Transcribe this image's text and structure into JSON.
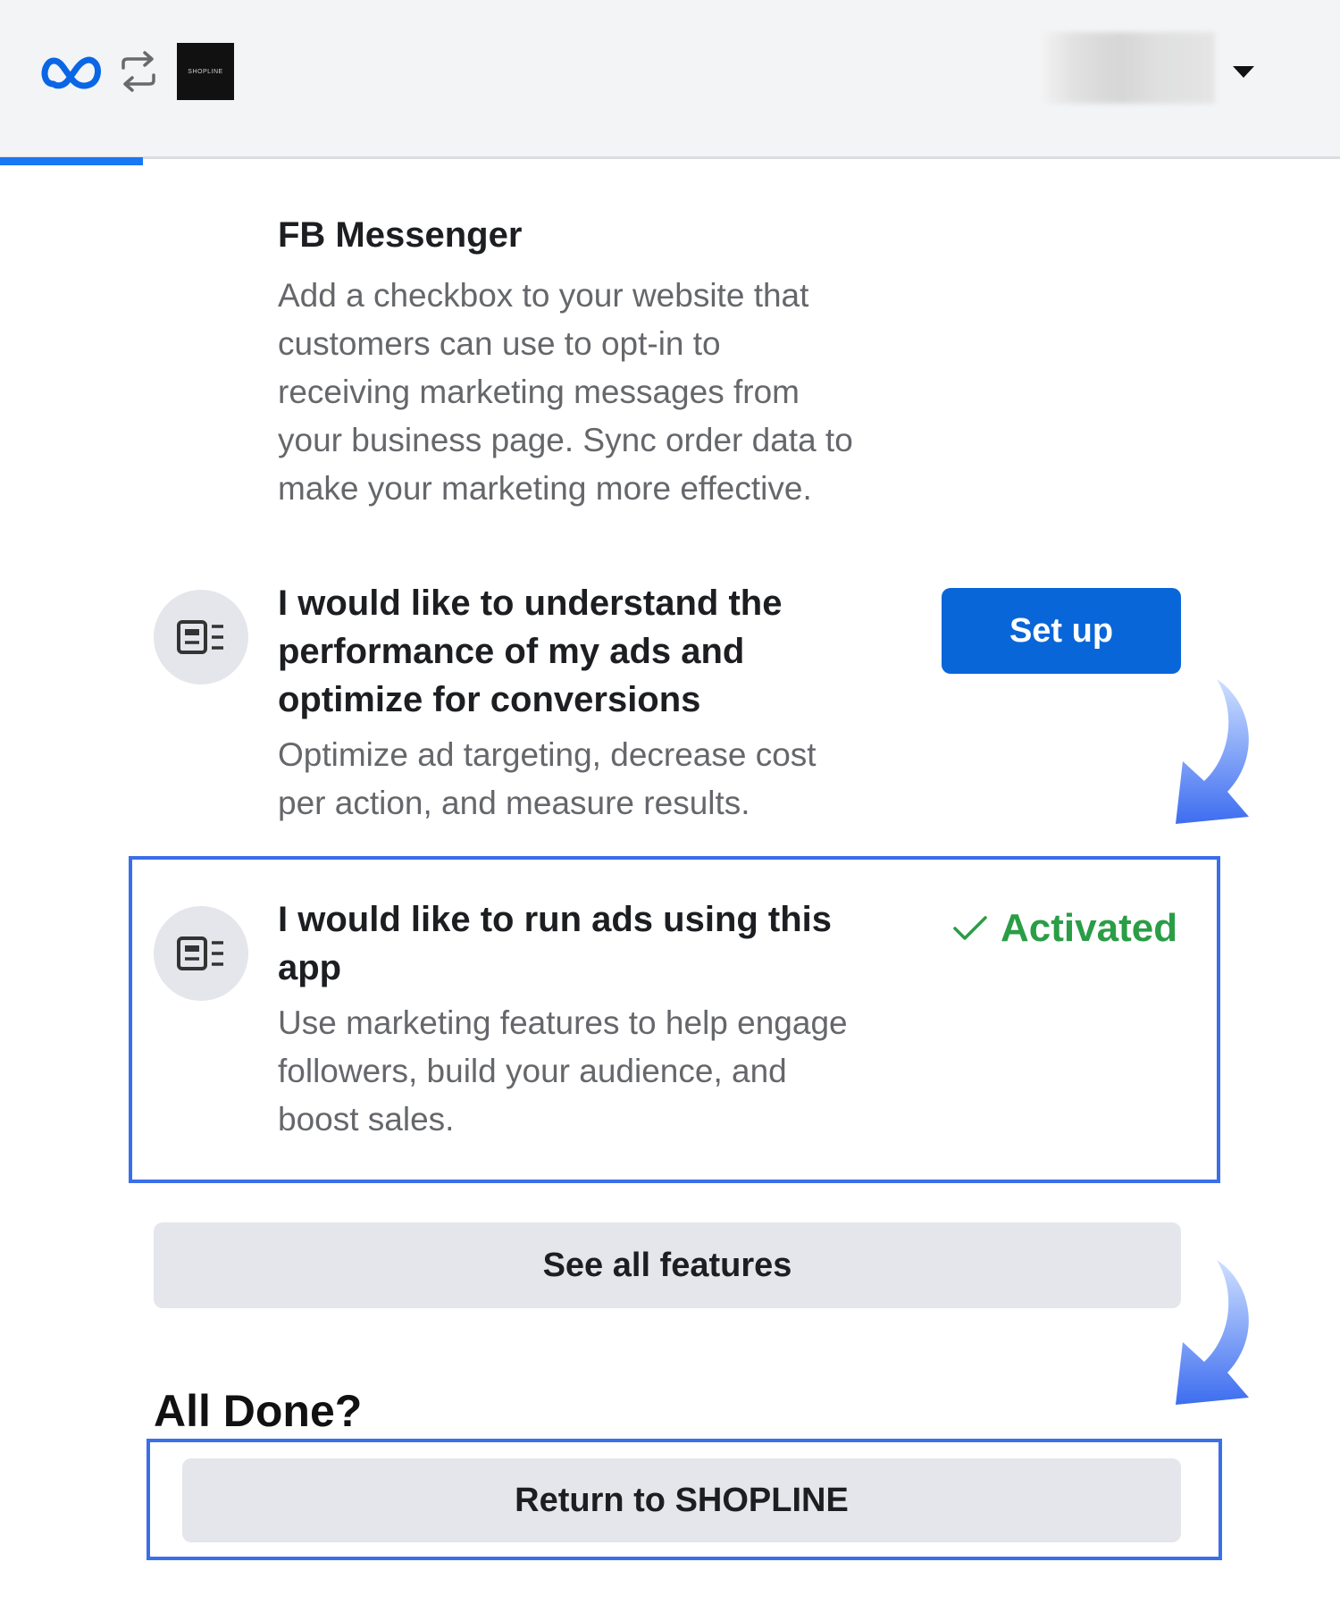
{
  "header": {
    "app_logo_text": "SHOPLINE",
    "account_name_redacted": ""
  },
  "features": [
    {
      "title": "FB Messenger",
      "description": [
        "Add a checkbox to your website that",
        "customers can use to opt-in to",
        "receiving marketing messages from",
        "your business page. Sync order data to",
        "make your marketing more effective."
      ]
    },
    {
      "title": [
        "I would like to understand the",
        "performance of my ads and",
        "optimize for conversions"
      ],
      "description": [
        "Optimize ad targeting, decrease cost",
        "per action, and measure results."
      ],
      "action_label": "Set up"
    },
    {
      "title": [
        "I would like to run ads using this",
        "app"
      ],
      "description": [
        "Use marketing features to help engage",
        "followers, build your audience, and",
        "boost sales."
      ],
      "status_label": "Activated"
    }
  ],
  "see_all_label": "See all features",
  "all_done_label": "All Done?",
  "return_label": "Return to SHOPLINE",
  "colors": {
    "primary": "#0866d8",
    "activated": "#2a9d46",
    "highlight": "#3b6fe8",
    "secondary_bg": "#e4e6eb"
  }
}
